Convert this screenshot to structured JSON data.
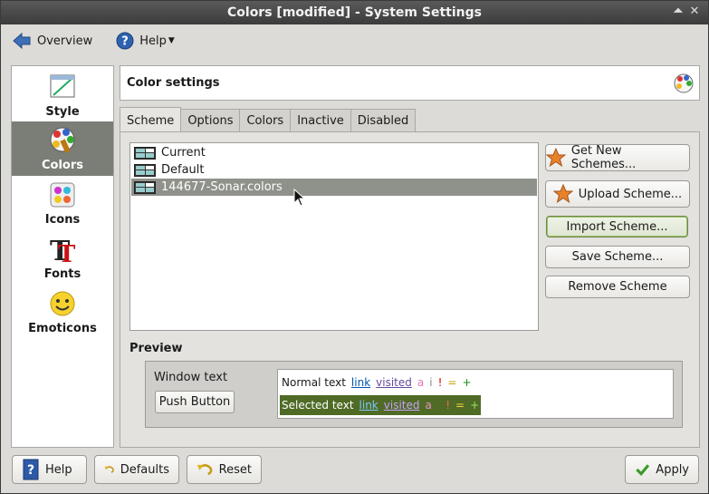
{
  "window": {
    "title": "Colors [modified] - System Settings"
  },
  "toolbar": {
    "overview": "Overview",
    "help": "Help"
  },
  "sidebar": {
    "items": [
      {
        "label": "Style"
      },
      {
        "label": "Colors",
        "active": true
      },
      {
        "label": "Icons"
      },
      {
        "label": "Fonts"
      },
      {
        "label": "Emoticons"
      }
    ]
  },
  "header": {
    "title": "Color settings"
  },
  "tabs": [
    {
      "label": "Scheme",
      "active": true
    },
    {
      "label": "Options"
    },
    {
      "label": "Colors"
    },
    {
      "label": "Inactive"
    },
    {
      "label": "Disabled"
    }
  ],
  "schemes": [
    {
      "name": "Current"
    },
    {
      "name": "Default"
    },
    {
      "name": "144677-Sonar.colors",
      "selected": true
    }
  ],
  "scheme_buttons": {
    "get_new": "Get New Schemes...",
    "upload": "Upload Scheme...",
    "import": "Import Scheme...",
    "save": "Save Scheme...",
    "remove": "Remove Scheme"
  },
  "preview": {
    "title": "Preview",
    "window_text": "Window text",
    "push_button": "Push Button",
    "normal": {
      "text": "Normal text",
      "link": "link",
      "visited": "visited",
      "a": "a",
      "i": "i",
      "bang": "!",
      "eq": "=",
      "plus": "+"
    },
    "selected": {
      "text": "Selected text",
      "link": "link",
      "visited": "visited",
      "a": "a",
      "i": "i",
      "bang": "!",
      "eq": "=",
      "plus": "+"
    }
  },
  "bottom": {
    "help": "Help",
    "defaults": "Defaults",
    "reset": "Reset",
    "apply": "Apply"
  },
  "colors": {
    "selection": "#8f928b",
    "preview_selection": "#4f6b25",
    "link": "#0057ae",
    "visited": "#644a9b"
  }
}
